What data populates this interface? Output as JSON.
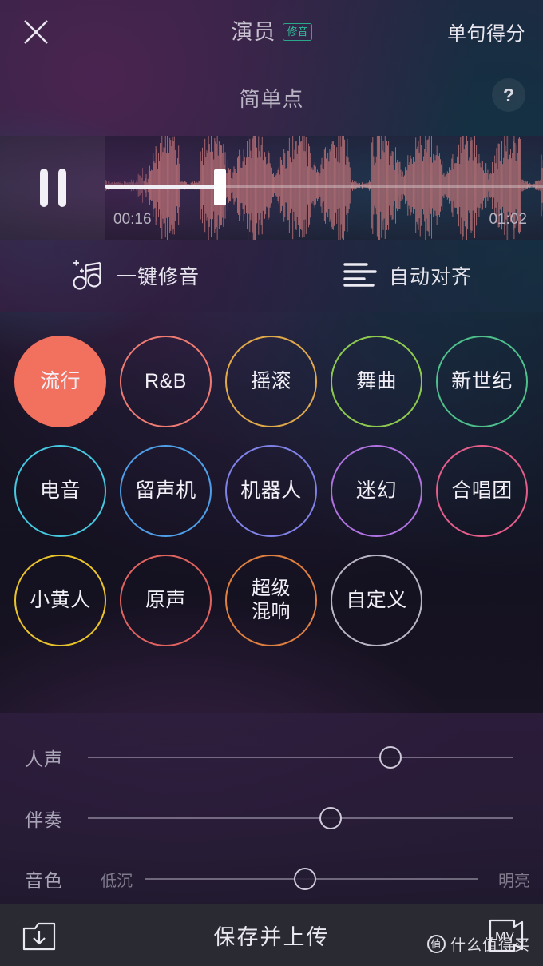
{
  "topbar": {
    "close_icon": "close-icon",
    "title": "演员",
    "badge": "修音",
    "score_label": "单句得分"
  },
  "song": {
    "title": "简单点",
    "help_label": "?"
  },
  "player": {
    "state_icon": "pause-icon",
    "current_time": "00:16",
    "total_time": "01:02",
    "progress_percent": 26
  },
  "tools": [
    {
      "icon": "music-note-sparkle-icon",
      "label": "一键修音"
    },
    {
      "icon": "align-lines-icon",
      "label": "自动对齐"
    }
  ],
  "effects": {
    "rows": [
      [
        {
          "label": "流行",
          "color": "#f2705e",
          "selected": true
        },
        {
          "label": "R&B",
          "color": "#ef7b72",
          "selected": false
        },
        {
          "label": "摇滚",
          "color": "#e0a949",
          "selected": false
        },
        {
          "label": "舞曲",
          "color": "#8ec94f",
          "selected": false
        },
        {
          "label": "新世纪",
          "color": "#4dc08c",
          "selected": false
        }
      ],
      [
        {
          "label": "电音",
          "color": "#45c8e0",
          "selected": false
        },
        {
          "label": "留声机",
          "color": "#4f9fe8",
          "selected": false
        },
        {
          "label": "机器人",
          "color": "#7f82e6",
          "selected": false
        },
        {
          "label": "迷幻",
          "color": "#b072e0",
          "selected": false
        },
        {
          "label": "合唱团",
          "color": "#e55d8a",
          "selected": false
        }
      ],
      [
        {
          "label": "小黄人",
          "color": "#e8c32b",
          "selected": false
        },
        {
          "label": "原声",
          "color": "#e0635f",
          "selected": false
        },
        {
          "label": "超级\n混响",
          "color": "#e08040",
          "selected": false,
          "two_line": true
        },
        {
          "label": "自定义",
          "color": "#b9b4c4",
          "selected": false
        }
      ]
    ]
  },
  "sliders": [
    {
      "name": "人声",
      "value_percent": 70,
      "left_label": "",
      "right_label": ""
    },
    {
      "name": "伴奏",
      "value_percent": 56,
      "left_label": "",
      "right_label": ""
    },
    {
      "name": "音色",
      "value_percent": 47,
      "left_label": "低沉",
      "right_label": "明亮"
    }
  ],
  "bottombar": {
    "save_icon": "save-download-icon",
    "save_label": "保存并上传",
    "mv_icon": "mv-icon",
    "mv_text": "MV"
  },
  "watermark": {
    "logo_text": "值",
    "text": "什么值得买"
  }
}
